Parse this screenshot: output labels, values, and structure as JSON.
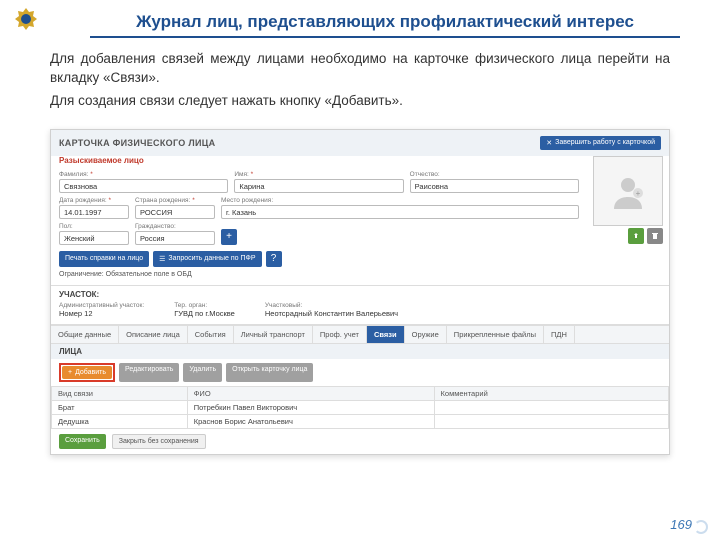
{
  "slide": {
    "title": "Журнал лиц, представляющих профилактический интерес",
    "p1": "Для добавления связей между лицами необходимо на карточке физического лица перейти на вкладку «Связи».",
    "p2": "Для создания связи следует нажать кнопку «Добавить».",
    "page": "169"
  },
  "card": {
    "title": "КАРТОЧКА ФИЗИЧЕСКОГО ЛИЦА",
    "close_btn": "Завершить работу с карточкой",
    "section_person": "Разыскиваемое лицо",
    "labels": {
      "surname": "Фамилия:",
      "name": "Имя:",
      "patronymic": "Отчество:",
      "dob": "Дата рождения:",
      "country": "Страна рождения:",
      "birthplace": "Место рождения:",
      "sex": "Пол:",
      "citizenship": "Гражданство:"
    },
    "values": {
      "surname": "Связнова",
      "name": "Карина",
      "patronymic": "Раисовна",
      "dob": "14.01.1997",
      "country": "РОССИЯ",
      "birthplace": "г. Казань",
      "sex": "Женский",
      "citizenship": "Россия"
    },
    "btns": {
      "print": "Печать справки на лицо",
      "request": "Запросить данные по ПФР"
    },
    "limit": "Ограничение: Обязательное поле в ОБД",
    "uchastok": {
      "title": "УЧАСТОК:",
      "adm_label": "Административный участок:",
      "adm_val": "Номер 12",
      "org_label": "Тер. орган:",
      "org_val": "ГУВД по г.Москве",
      "officer_label": "Участковый:",
      "officer_val": "Неотсрадный Константин Валерьевич"
    },
    "tabs": [
      "Общие данные",
      "Описание лица",
      "События",
      "Личный транспорт",
      "Проф. учет",
      "Связи",
      "Оружие",
      "Прикрепленные файлы",
      "ПДН"
    ],
    "active_tab": 5,
    "links_section": "ЛИЦА",
    "toolbar": {
      "add": "Добавить",
      "edit": "Редактировать",
      "del": "Удалить",
      "open": "Открыть карточку лица"
    },
    "table": {
      "headers": [
        "Вид связи",
        "ФИО",
        "Комментарий"
      ],
      "rows": [
        [
          "Брат",
          "Потребкин Павел Викторович",
          ""
        ],
        [
          "Дедушка",
          "Краснов Борис Анатольевич",
          ""
        ]
      ]
    },
    "footer": {
      "save": "Сохранить",
      "cancel": "Закрыть без сохранения"
    }
  }
}
